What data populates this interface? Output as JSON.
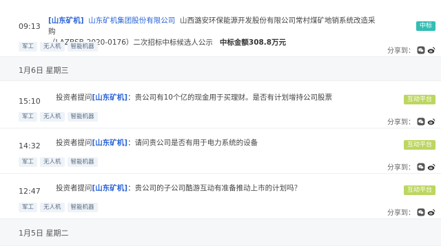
{
  "items": [
    {
      "time": "09:13",
      "company_tag": "[山东矿机]",
      "company_name": "山东矿机集团股份有限公司",
      "text1": "山西潞安环保能源开发股份有限公司常村煤矿地销系统改造采购",
      "text2": "（LAZBSB-2020-0176）二次招标中标候选人公示",
      "amount": "中标金额308.8万元",
      "badge": "中标",
      "tags": [
        "军工",
        "无人机",
        "智能机器"
      ],
      "share_label": "分享到："
    },
    {
      "time": "15:10",
      "prefix": "投资者提问",
      "company_tag": "[山东矿机]",
      "question": "：贵公司有10个亿的现金用于买理财。是否有计划增持公司股票",
      "badge": "互动平台",
      "tags": [
        "军工",
        "无人机",
        "智能机器"
      ],
      "share_label": "分享到："
    },
    {
      "time": "14:32",
      "prefix": "投资者提问",
      "company_tag": "[山东矿机]",
      "question": "：请问贵公司是否有用于电力系统的设备",
      "badge": "互动平台",
      "tags": [
        "军工",
        "无人机",
        "智能机器"
      ],
      "share_label": "分享到："
    },
    {
      "time": "12:47",
      "prefix": "投资者提问",
      "company_tag": "[山东矿机]",
      "question": "：贵公司的子公司酷游互动有准备推动上市的计划吗？",
      "badge": "互动平台",
      "tags": [
        "军工",
        "无人机",
        "智能机器"
      ],
      "share_label": "分享到："
    }
  ],
  "dates": [
    "1月6日  星期三",
    "1月5日  星期二"
  ],
  "colors": {
    "accent": "#2a63d6",
    "badge_teal": "#33bdb4",
    "badge_green": "#bcd660"
  },
  "icons": {
    "share_wechat": "wechat-icon",
    "share_weibo": "weibo-icon"
  }
}
